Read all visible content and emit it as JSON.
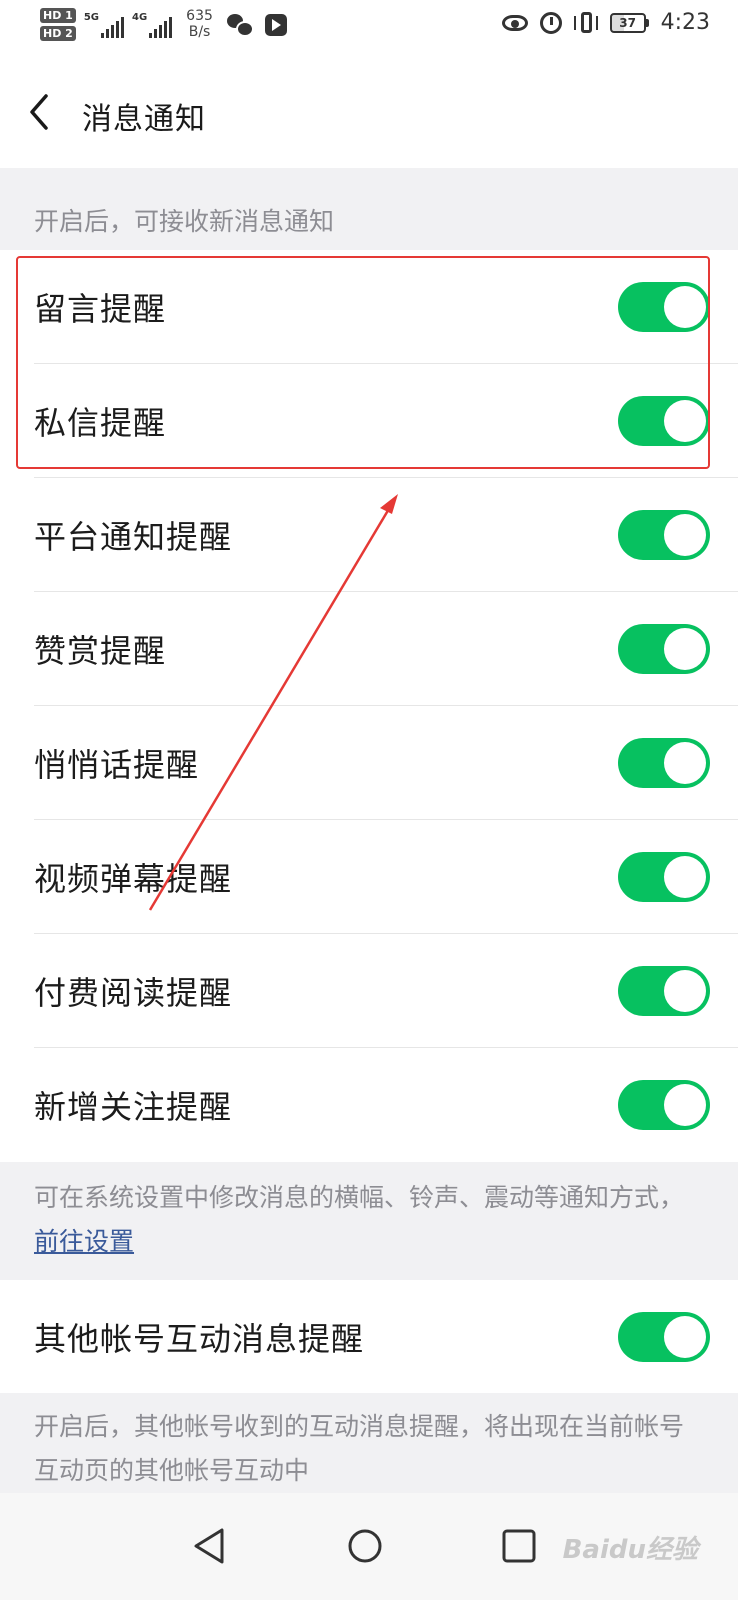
{
  "status_bar": {
    "hd1": "HD 1",
    "hd2": "HD 2",
    "net1": "5G",
    "net2": "4G",
    "speed_value": "635",
    "speed_unit": "B/s",
    "battery": "37",
    "time": "4:23"
  },
  "header": {
    "title": "消息通知"
  },
  "intro_caption": "开启后，可接收新消息通知",
  "settings": [
    {
      "label": "留言提醒",
      "on": true
    },
    {
      "label": "私信提醒",
      "on": true
    },
    {
      "label": "平台通知提醒",
      "on": true
    },
    {
      "label": "赞赏提醒",
      "on": true
    },
    {
      "label": "悄悄话提醒",
      "on": true
    },
    {
      "label": "视频弹幕提醒",
      "on": true
    },
    {
      "label": "付费阅读提醒",
      "on": true
    },
    {
      "label": "新增关注提醒",
      "on": true
    }
  ],
  "system_caption": {
    "text": "可在系统设置中修改消息的横幅、铃声、震动等通知方式，",
    "link": "前往设置"
  },
  "other_accounts": {
    "label": "其他帐号互动消息提醒",
    "on": true
  },
  "other_caption": "开启后，其他帐号收到的互动消息提醒，将出现在当前帐号互动页的其他帐号互动中",
  "watermark": "Baidu经验",
  "colors": {
    "toggle_on": "#07c160",
    "annotation": "#e53935",
    "link": "#3a5a9a"
  }
}
